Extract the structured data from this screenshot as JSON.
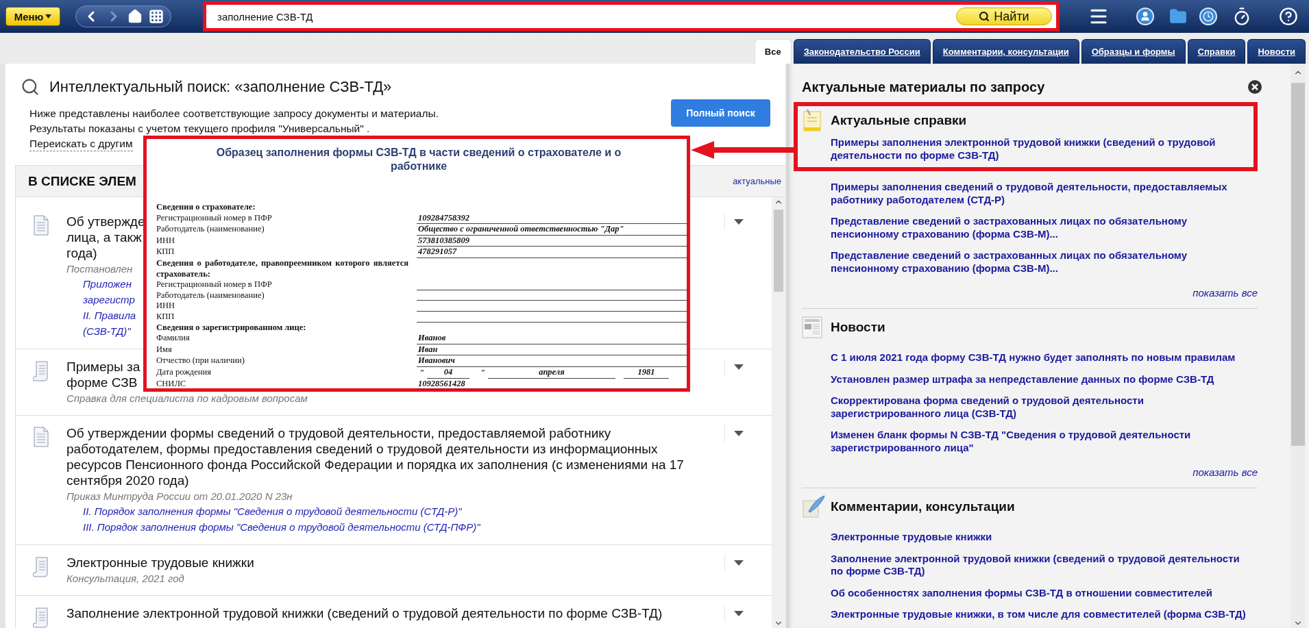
{
  "toolbar": {
    "menu_label": "Меню",
    "search": {
      "value": "заполнение СЗВ-ТД"
    },
    "search_button": "Найти"
  },
  "tabs": [
    {
      "label": "Все",
      "selected": true
    },
    {
      "label": "Законодательство России",
      "selected": false
    },
    {
      "label": "Комментарии, консультации",
      "selected": false
    },
    {
      "label": "Образцы и формы",
      "selected": false
    },
    {
      "label": "Справки",
      "selected": false
    },
    {
      "label": "Новости",
      "selected": false
    }
  ],
  "search_header": {
    "title": "Интеллектуальный поиск: «заполнение СЗВ-ТД»",
    "description": [
      "Ниже представлены наиболее соответствующие запросу документы и материалы.",
      "Результаты показаны с учетом текущего профиля \"Универсальный\" ."
    ],
    "research_link": "Переискать с другим",
    "full_search_button": "Полный поиск"
  },
  "results": {
    "header": "В СПИСКЕ ЭЛЕМ",
    "filter_link": "актуальные",
    "items": [
      {
        "kind": "document",
        "title_lines": [
          "Об утвержде",
          "лица, а такж",
          "года)"
        ],
        "meta": "Постановлен",
        "links": [
          [
            "Приложен",
            "зарегистр"
          ],
          [
            "II. Правила",
            "(СЗВ-ТД)\""
          ]
        ]
      },
      {
        "kind": "scroll",
        "title_lines": [
          "Примеры за",
          "форме СЗВ"
        ],
        "meta": "Справка для специалиста по кадровым вопросам"
      },
      {
        "kind": "document",
        "title_lines": [
          "Об утверждении формы сведений о трудовой деятельности, предоставляемой работнику работодателем, формы предоставления сведений о трудовой деятельности из информационных ресурсов Пенсионного фонда Российской Федерации и порядка их заполнения (с изменениями на 17 сентября 2020 года)"
        ],
        "meta": "Приказ Минтруда России от 20.01.2020 N 23н",
        "links": [
          [
            "II. Порядок заполнения формы \"Сведения о трудовой деятельности (СТД-Р)\""
          ],
          [
            "III. Порядок заполнения формы \"Сведения о трудовой деятельности (СТД-ПФР)\""
          ]
        ]
      },
      {
        "kind": "scroll",
        "title_lines": [
          "Электронные трудовые книжки"
        ],
        "meta": "Консультация, 2021 год"
      },
      {
        "kind": "scroll",
        "title_lines": [
          "Заполнение электронной трудовой книжки (сведений о трудовой деятельности по форме СЗВ-ТД)"
        ]
      }
    ]
  },
  "preview": {
    "title": "Образец заполнения формы СЗВ-ТД в части сведений о страхователе и о работнике",
    "rows": [
      {
        "kind": "section",
        "label": "Сведения о страхователе:"
      },
      {
        "kind": "field",
        "label": "Регистрационный номер в ПФР",
        "value": "109284758392"
      },
      {
        "kind": "field",
        "label": "Работодатель (наименование)",
        "value": "Общество с ограниченной ответственностью \"Дар\""
      },
      {
        "kind": "field",
        "label": "ИНН",
        "value": "573810385809"
      },
      {
        "kind": "field",
        "label": "КПП",
        "value": "478291057"
      },
      {
        "kind": "section",
        "label": "Сведения о работодателе, правопреемником которого является страхователь:"
      },
      {
        "kind": "field",
        "label": "Регистрационный номер в ПФР"
      },
      {
        "kind": "field",
        "label": "Работодатель (наименование)"
      },
      {
        "kind": "field",
        "label": "ИНН"
      },
      {
        "kind": "field",
        "label": "КПП"
      },
      {
        "kind": "section",
        "label": "Сведения о зарегистрированном лице:"
      },
      {
        "kind": "field",
        "label": "Фамилия",
        "value": "Иванов"
      },
      {
        "kind": "field",
        "label": "Имя",
        "value": "Иван"
      },
      {
        "kind": "field",
        "label": "Отчество (при наличии)",
        "value": "Иванович"
      },
      {
        "kind": "date",
        "label": "Дата рождения",
        "open_quote": "\"",
        "day": "04",
        "close_quote": "\"",
        "month": "апреля",
        "year": "1981"
      },
      {
        "kind": "field",
        "label": "СНИЛС",
        "value": "10928561428"
      }
    ]
  },
  "related": {
    "title": "Актуальные материалы по запросу",
    "sections": [
      {
        "kind": "references",
        "heading": "Актуальные справки",
        "show_all": "показать все",
        "links": [
          {
            "text": "Примеры заполнения электронной трудовой книжки (сведений о трудовой деятельности по форме СЗВ-ТД)",
            "highlighted": true
          },
          {
            "text": "Примеры заполнения сведений о трудовой деятельности, предоставляемых работнику работодателем (СТД-Р)",
            "highlighted": false
          },
          {
            "text": "Представление сведений о застрахованных лицах по обязательному пенсионному страхованию (форма СЗВ-М)...",
            "highlighted": false
          },
          {
            "text": "Представление сведений о застрахованных лицах по обязательному пенсионному страхованию (форма СЗВ-М)...",
            "highlighted": false
          }
        ]
      },
      {
        "kind": "news",
        "heading": "Новости",
        "show_all": "показать все",
        "links": [
          {
            "text": "С 1 июля 2021 года форму СЗВ-ТД нужно будет заполнять по новым правилам",
            "highlighted": false
          },
          {
            "text": "Установлен размер штрафа за непредставление данных по форме СЗВ-ТД",
            "highlighted": false
          },
          {
            "text": "Скорректирована форма сведений о трудовой деятельности зарегистрированного лица (СЗВ-ТД)",
            "highlighted": false
          },
          {
            "text": "Изменен бланк формы N СЗВ-ТД \"Сведения о трудовой деятельности зарегистрированного лица\"",
            "highlighted": false
          }
        ]
      },
      {
        "kind": "comments",
        "heading": "Комментарии, консультации",
        "links": [
          {
            "text": "Электронные трудовые книжки",
            "highlighted": false
          },
          {
            "text": "Заполнение электронной трудовой книжки (сведений о трудовой деятельности по форме СЗВ-ТД)",
            "highlighted": false
          },
          {
            "text": "Об особенностях заполнения формы СЗВ-ТД в отношении совместителей",
            "highlighted": false
          },
          {
            "text": "Электронные трудовые книжки, в том числе для совместителей (форма СЗВ-ТД)",
            "highlighted": false
          }
        ]
      }
    ]
  }
}
